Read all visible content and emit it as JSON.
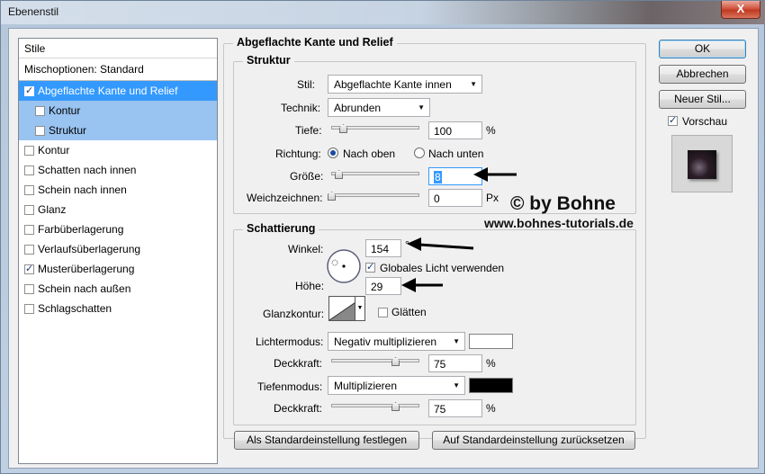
{
  "window": {
    "title": "Ebenenstil",
    "close_label": "X"
  },
  "sidebar": {
    "header": "Stile",
    "blend_options": "Mischoptionen: Standard",
    "items": [
      {
        "label": "Abgeflachte Kante und Relief",
        "checked": true,
        "selected": true
      },
      {
        "label": "Kontur",
        "checked": false,
        "sub": true
      },
      {
        "label": "Struktur",
        "checked": false,
        "sub": true
      },
      {
        "label": "Kontur",
        "checked": false
      },
      {
        "label": "Schatten nach innen",
        "checked": false
      },
      {
        "label": "Schein nach innen",
        "checked": false
      },
      {
        "label": "Glanz",
        "checked": false
      },
      {
        "label": "Farbüberlagerung",
        "checked": false
      },
      {
        "label": "Verlaufsüberlagerung",
        "checked": false
      },
      {
        "label": "Musterüberlagerung",
        "checked": true
      },
      {
        "label": "Schein nach außen",
        "checked": false
      },
      {
        "label": "Schlagschatten",
        "checked": false
      }
    ]
  },
  "bevel": {
    "title": "Abgeflachte Kante und Relief",
    "structure": {
      "title": "Struktur",
      "style_label": "Stil:",
      "style_value": "Abgeflachte Kante innen",
      "technique_label": "Technik:",
      "technique_value": "Abrunden",
      "depth_label": "Tiefe:",
      "depth_value": "100",
      "depth_unit": "%",
      "depth_slider": 0.1,
      "direction_label": "Richtung:",
      "direction_up": "Nach oben",
      "direction_down": "Nach unten",
      "size_label": "Größe:",
      "size_value": "8",
      "size_slider": 0.05,
      "soften_label": "Weichzeichnen:",
      "soften_value": "0",
      "soften_unit": "Px",
      "soften_slider": 0.0
    },
    "shading": {
      "title": "Schattierung",
      "angle_label": "Winkel:",
      "angle_value": "154",
      "angle_unit": "°",
      "global_light_label": "Globales Licht verwenden",
      "global_light_checked": true,
      "altitude_label": "Höhe:",
      "altitude_value": "29",
      "gloss_contour_label": "Glanzkontur:",
      "antialias_label": "Glätten",
      "highlight_mode_label": "Lichtermodus:",
      "highlight_mode_value": "Negativ multiplizieren",
      "highlight_color": "#ffffff",
      "highlight_opacity_label": "Deckkraft:",
      "highlight_opacity_value": "75",
      "highlight_opacity_unit": "%",
      "shadow_mode_label": "Tiefenmodus:",
      "shadow_mode_value": "Multiplizieren",
      "shadow_color": "#000000",
      "shadow_opacity_label": "Deckkraft:",
      "shadow_opacity_value": "75",
      "shadow_opacity_unit": "%"
    },
    "make_default": "Als Standardeinstellung festlegen",
    "reset_default": "Auf Standardeinstellung zurücksetzen"
  },
  "buttons": {
    "ok": "OK",
    "cancel": "Abbrechen",
    "new_style": "Neuer Stil..."
  },
  "preview": {
    "label": "Vorschau",
    "checked": true
  },
  "watermark": {
    "line1": "© by Bohne",
    "line2": "www.bohnes-tutorials.de"
  }
}
